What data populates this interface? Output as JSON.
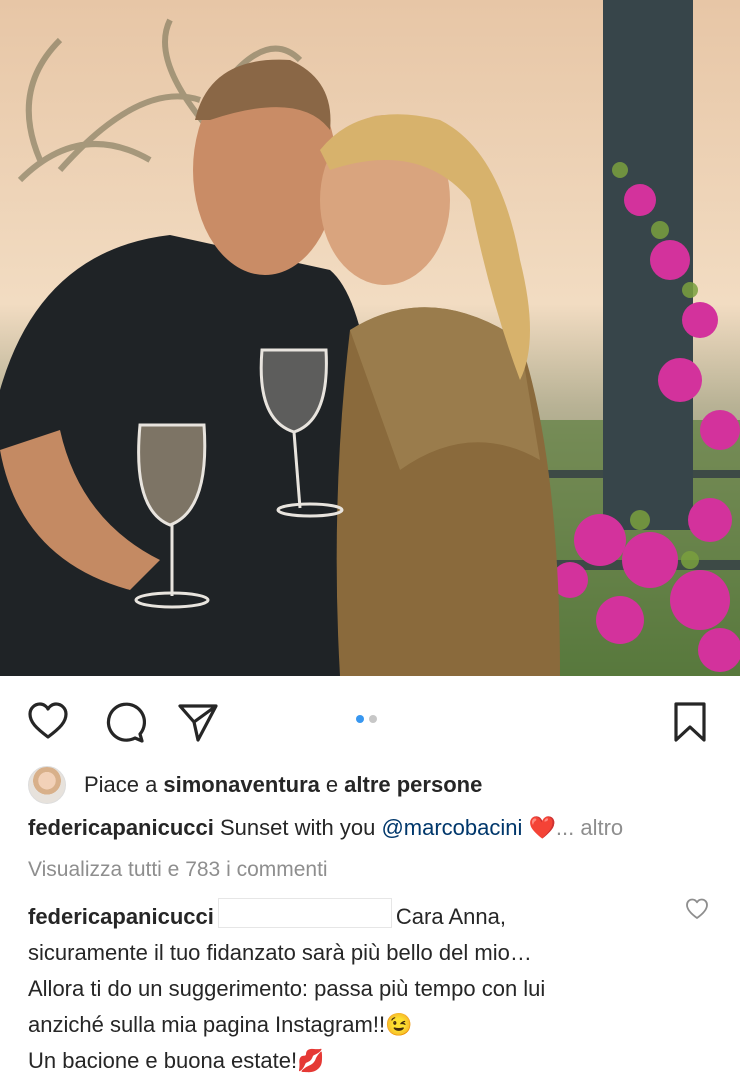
{
  "actions": {
    "like_icon": "heart-outline-icon",
    "comment_icon": "speech-bubble-icon",
    "share_icon": "paper-plane-icon",
    "save_icon": "bookmark-icon",
    "carousel": {
      "count": 2,
      "active_index": 0
    }
  },
  "likes": {
    "prefix": "Piace a",
    "user": "simonaventura",
    "conjunction": "e",
    "others": "altre persone"
  },
  "caption": {
    "author": "federicapanicucci",
    "text": "Sunset with you",
    "mention": "@marcobacini",
    "emoji": "❤️",
    "more": "... altro"
  },
  "comments": {
    "view_all": "Visualizza tutti e 783 i commenti"
  },
  "reply": {
    "author": "federicapanicucci",
    "line1": "Cara Anna,",
    "line2": "sicuramente il tuo fidanzato sarà più bello del mio…",
    "line3": "Allora ti do un suggerimento: passa più tempo con lui",
    "line4": "anziché sulla mia pagina Instagram!!😉",
    "line5": "Un bacione e buona estate!💋"
  },
  "colors": {
    "text": "#262626",
    "muted": "#8e8e8e",
    "mention": "#00376b",
    "carousel_active": "#3897f0",
    "heart_emoji": "#e0245e"
  }
}
